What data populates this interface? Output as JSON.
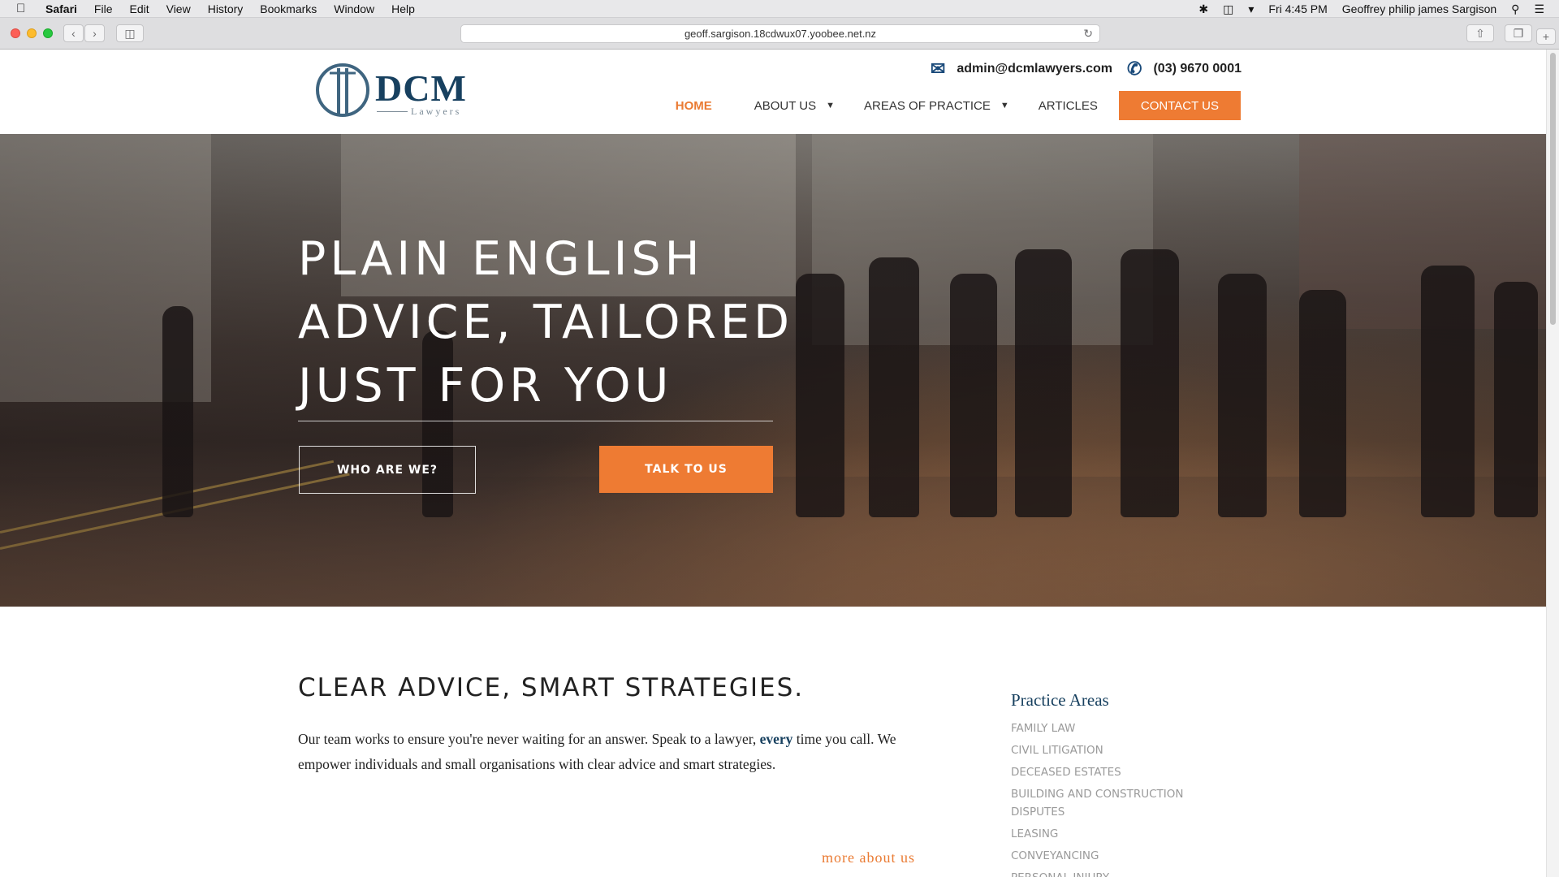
{
  "menubar": {
    "app": "Safari",
    "items": [
      "File",
      "Edit",
      "View",
      "History",
      "Bookmarks",
      "Window",
      "Help"
    ],
    "clock": "Fri 4:45 PM",
    "user": "Geoffrey philip james Sargison"
  },
  "browser": {
    "url": "geoff.sargison.18cdwux07.yoobee.net.nz"
  },
  "header": {
    "logo_main": "DCM",
    "logo_sub": "Lawyers",
    "email": "admin@dcmlawyers.com",
    "phone": "(03) 9670 0001"
  },
  "nav": {
    "home": "HOME",
    "about": "ABOUT US",
    "areas": "AREAS OF PRACTICE",
    "articles": "ARTICLES",
    "contact": "CONTACT US"
  },
  "hero": {
    "title_lines": [
      "PLAIN ENGLISH",
      "ADVICE, TAILORED",
      "JUST FOR YOU"
    ],
    "btn_who": "WHO ARE WE?",
    "btn_talk": "TALK TO US"
  },
  "intro": {
    "title": "CLEAR ADVICE, SMART STRATEGIES.",
    "text_before": "Our team works to ensure you're never waiting for an answer. Speak to a lawyer, ",
    "text_em": "every",
    "text_after": " time you call. We empower individuals and small organisations with clear advice and smart strategies.",
    "more": "more about us"
  },
  "practice_areas": {
    "heading": "Practice Areas",
    "items": [
      "FAMILY LAW",
      "CIVIL LITIGATION",
      "DECEASED ESTATES",
      "BUILDING AND CONSTRUCTION DISPUTES",
      "LEASING",
      "CONVEYANCING",
      "PERSONAL INJURY"
    ]
  },
  "colors": {
    "accent": "#ee7b33",
    "brand_navy": "#17405f"
  }
}
